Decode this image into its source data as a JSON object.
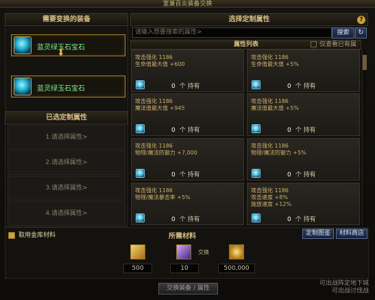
{
  "window": {
    "title": "室兼百炎装备交换"
  },
  "left": {
    "header": "需要变换的装备",
    "slot_top_label": "蓝灵绿玉石宝石",
    "slot_bottom_label": "蓝灵绿玉石宝石",
    "selected_header": "已选定制属性",
    "selected_rows": [
      "1.请选择属性>",
      "2.请选择属性>",
      "3.请选择属性>",
      "4.请选择属性>"
    ]
  },
  "right": {
    "header": "选择定制属性",
    "search_placeholder": "请输入想要搜索的属性>",
    "search_button": "搜索",
    "refresh_icon": "↻",
    "list_header": "属性列表",
    "only_owned_label": "仅查看已有属性",
    "cards": [
      {
        "l1": "攻击强化 1186",
        "l2": "生命值最大值 +600",
        "l3": "",
        "count": "0",
        "owned": "个 持有"
      },
      {
        "l1": "攻击强化 1186",
        "l2": "生命值最大值 +5%",
        "l3": "",
        "count": "0",
        "owned": "个 持有"
      },
      {
        "l1": "攻击强化 1186",
        "l2": "魔法值最大值 +945",
        "l3": "",
        "count": "0",
        "owned": "个 持有"
      },
      {
        "l1": "攻击强化 1186",
        "l2": "魔法值最大值 +5%",
        "l3": "",
        "count": "0",
        "owned": "个 持有"
      },
      {
        "l1": "攻击强化 1186",
        "l2": "物理/魔法防御力 +7,000",
        "l3": "",
        "count": "0",
        "owned": "个 持有"
      },
      {
        "l1": "攻击强化 1186",
        "l2": "物理/魔法防御力 +5%",
        "l3": "",
        "count": "0",
        "owned": "个 持有"
      },
      {
        "l1": "攻击强化 1186",
        "l2": "物理/魔法暴击率 +5%",
        "l3": "",
        "count": "0",
        "owned": "个 持有"
      },
      {
        "l1": "攻击强化 1186",
        "l2": "攻击速度 +8%",
        "l3": "施放速度 +12%",
        "count": "0",
        "owned": "个 持有"
      }
    ]
  },
  "bottom": {
    "use_storage": "取用金库材料",
    "materials_title": "所需材料",
    "custom_guide_btn": "定制图鉴",
    "material_shop_btn": "材料商店",
    "material_qty": [
      "500",
      "10",
      "500,000"
    ],
    "exchange_label": "交换",
    "exchange_button": "交换装备 / 属性",
    "note": "可出战阵定地下城\n可出战讨伐战"
  },
  "colors": {
    "accent_gold": "#c9a23a",
    "positive_green": "#7ef08e",
    "button_blue": "#2d3b5c"
  }
}
